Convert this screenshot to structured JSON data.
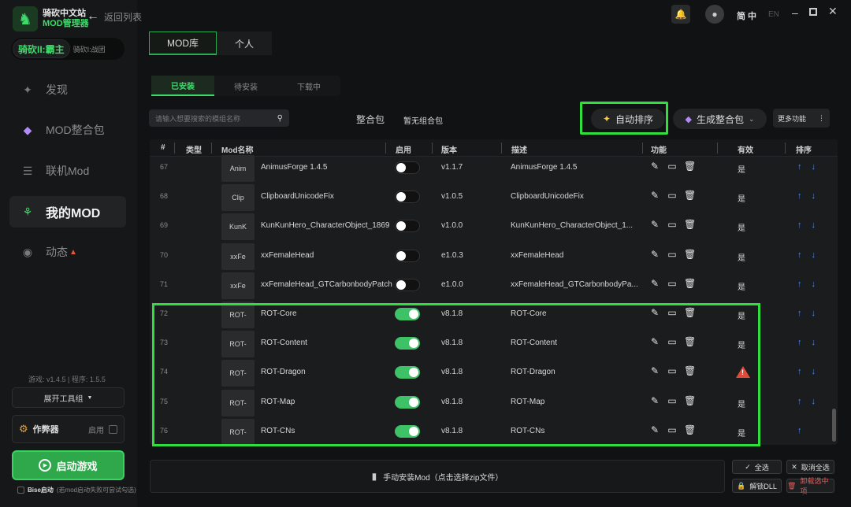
{
  "app": {
    "logo_line1": "骑砍中文站",
    "logo_line2": "MOD管理器",
    "back_label": "返回列表",
    "lang_current": "简 中",
    "lang_alt": "EN"
  },
  "sidebar": {
    "game_active": "骑砍II:霸主",
    "game_other": "骑砍I:战团",
    "nav": [
      {
        "label": "发现",
        "icon": "compass-icon",
        "active": false
      },
      {
        "label": "MOD整合包",
        "icon": "diamond-icon",
        "active": false
      },
      {
        "label": "联机Mod",
        "icon": "server-icon",
        "active": false
      },
      {
        "label": "我的MOD",
        "icon": "tree-icon",
        "active": true
      },
      {
        "label": "动态",
        "icon": "chat-icon",
        "active": false,
        "badge": "fire"
      }
    ],
    "version": "游戏: v1.4.5 | 程序: 1.5.5",
    "toolbar_btn": "展开工具组",
    "cheat_label": "作弊器",
    "cheat_enable": "启用",
    "launch_label": "启动游戏",
    "bise_label": "Bise启动",
    "bise_hint": "(若mod启动失败可尝试勾选)"
  },
  "tabs_top": [
    "MOD库",
    "个人"
  ],
  "tabs_sub": [
    "已安装",
    "待安装",
    "下载中"
  ],
  "toolbar": {
    "search_placeholder": "请输入想要搜索的模组名称",
    "pack_label": "整合包",
    "pack_value": "暂无组合包",
    "autosort_label": "自动排序",
    "genpack_label": "生成整合包",
    "more_label": "更多功能"
  },
  "table": {
    "headers": [
      "#",
      "类型",
      "Mod名称",
      "启用",
      "版本",
      "描述",
      "功能",
      "有效",
      "排序"
    ],
    "rows": [
      {
        "num": "67",
        "thumb": "Anim",
        "name": "AnimusForge 1.4.5",
        "enabled": false,
        "version": "v1.1.7",
        "desc": "AnimusForge 1.4.5",
        "valid": "是",
        "warn": false,
        "down": true
      },
      {
        "num": "68",
        "thumb": "Clip",
        "name": "ClipboardUnicodeFix",
        "enabled": false,
        "version": "v1.0.5",
        "desc": "ClipboardUnicodeFix",
        "valid": "是",
        "warn": false,
        "down": true
      },
      {
        "num": "69",
        "thumb": "KunK",
        "name": "KunKunHero_CharacterObject_1869",
        "enabled": false,
        "version": "v1.0.0",
        "desc": "KunKunHero_CharacterObject_1...",
        "valid": "是",
        "warn": false,
        "down": true
      },
      {
        "num": "70",
        "thumb": "xxFe",
        "name": "xxFemaleHead",
        "enabled": false,
        "version": "e1.0.3",
        "desc": "xxFemaleHead",
        "valid": "是",
        "warn": false,
        "down": true
      },
      {
        "num": "71",
        "thumb": "xxFe",
        "name": "xxFemaleHead_GTCarbonbodyPatch",
        "enabled": false,
        "version": "e1.0.0",
        "desc": "xxFemaleHead_GTCarbonbodyPa...",
        "valid": "是",
        "warn": false,
        "down": true
      },
      {
        "num": "72",
        "thumb": "ROT-",
        "name": "ROT-Core",
        "enabled": true,
        "version": "v8.1.8",
        "desc": "ROT-Core",
        "valid": "是",
        "warn": false,
        "down": true
      },
      {
        "num": "73",
        "thumb": "ROT-",
        "name": "ROT-Content",
        "enabled": true,
        "version": "v8.1.8",
        "desc": "ROT-Content",
        "valid": "是",
        "warn": false,
        "down": true
      },
      {
        "num": "74",
        "thumb": "ROT-",
        "name": "ROT-Dragon",
        "enabled": true,
        "version": "v8.1.8",
        "desc": "ROT-Dragon",
        "valid": "",
        "warn": true,
        "down": true
      },
      {
        "num": "75",
        "thumb": "ROT-",
        "name": "ROT-Map",
        "enabled": true,
        "version": "v8.1.8",
        "desc": "ROT-Map",
        "valid": "是",
        "warn": false,
        "down": true
      },
      {
        "num": "76",
        "thumb": "ROT-",
        "name": "ROT-CNs",
        "enabled": true,
        "version": "v8.1.8",
        "desc": "ROT-CNs",
        "valid": "是",
        "warn": false,
        "down": false
      }
    ]
  },
  "footer": {
    "install_label": "手动安装Mod（点击选择zip文件）",
    "select_all": "全选",
    "deselect_all": "取消全选",
    "unlock_dll": "解锁DLL",
    "uninstall": "卸载选中项"
  },
  "colors": {
    "accent": "#3ddc6a",
    "highlight": "#2fe03c",
    "sort_arrow": "#4a8cf2",
    "warn": "#e04a3a"
  }
}
